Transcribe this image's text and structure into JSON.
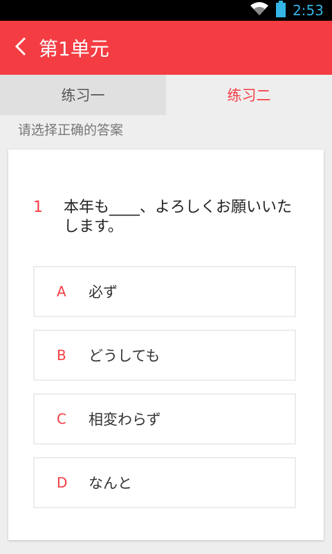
{
  "status": {
    "time": "2:53",
    "accent": "#33b5e5"
  },
  "header": {
    "title": "第1单元",
    "back_icon": "chevron-left-icon",
    "color": "#f43d43"
  },
  "tabs": [
    {
      "label": "练习一",
      "active": false
    },
    {
      "label": "练习二",
      "active": true
    }
  ],
  "instruction": "请选择正确的答案",
  "question": {
    "number": "1",
    "text": "本年も____、よろしくお願いいたします。"
  },
  "options": [
    {
      "letter": "A",
      "text": "必ず"
    },
    {
      "letter": "B",
      "text": "どうしても"
    },
    {
      "letter": "C",
      "text": "相変わらず"
    },
    {
      "letter": "D",
      "text": "なんと"
    }
  ]
}
